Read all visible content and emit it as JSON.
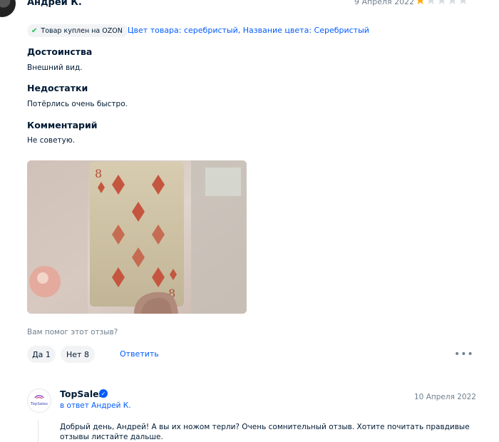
{
  "review": {
    "author": "Андрей К.",
    "date": "9 Апреля 2022",
    "rating": 1,
    "rating_max": 5,
    "badge": "Товар куплен на OZON",
    "attributes": "Цвет товара: серебристый, Название цвета: Серебристый",
    "sections": [
      {
        "title": "Достоинства",
        "text": "Внешний вид."
      },
      {
        "title": "Недостатки",
        "text": "Потёрлись очень быстро."
      },
      {
        "title": "Комментарий",
        "text": "Не советую."
      }
    ],
    "photo": {
      "card_rank": "8",
      "card_suit": "diamond"
    },
    "helpful_question": "Вам помог этот отзыв?",
    "yes_label": "Да 1",
    "no_label": "Нет 8",
    "reply_label": "Ответить",
    "more_icon": "more-horizontal-icon"
  },
  "seller_reply": {
    "name": "TopSales",
    "logo_text": "TopSales",
    "verified_icon": "verified-check-icon",
    "reply_to": "в ответ Андрей К.",
    "date": "10 Апреля 2022",
    "text": "Добрый день, Андрей! А вы их ножом терли? Очень сомнительный отзыв. Хотите почитать правдивые отзывы листайте дальше."
  },
  "colors": {
    "accent": "#005bff",
    "star_on": "#ffa800",
    "star_off": "#d6dbe0",
    "check": "#10c44c"
  }
}
